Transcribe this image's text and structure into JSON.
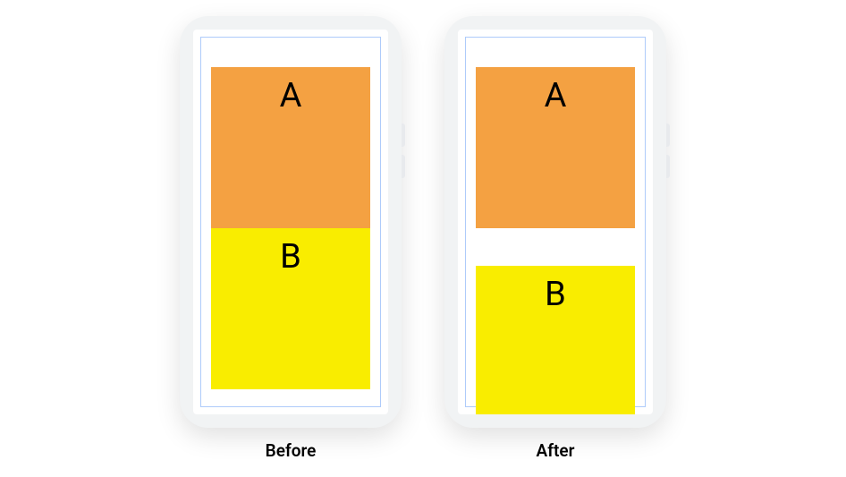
{
  "diagram": {
    "phones": [
      {
        "key": "before",
        "caption": "Before",
        "boxA": {
          "label": "A",
          "color": "#f4a142"
        },
        "boxB": {
          "label": "B",
          "color": "#f9ed00"
        }
      },
      {
        "key": "after",
        "caption": "After",
        "boxA": {
          "label": "A",
          "color": "#f4a142"
        },
        "boxB": {
          "label": "B",
          "color": "#f9ed00"
        }
      }
    ]
  }
}
